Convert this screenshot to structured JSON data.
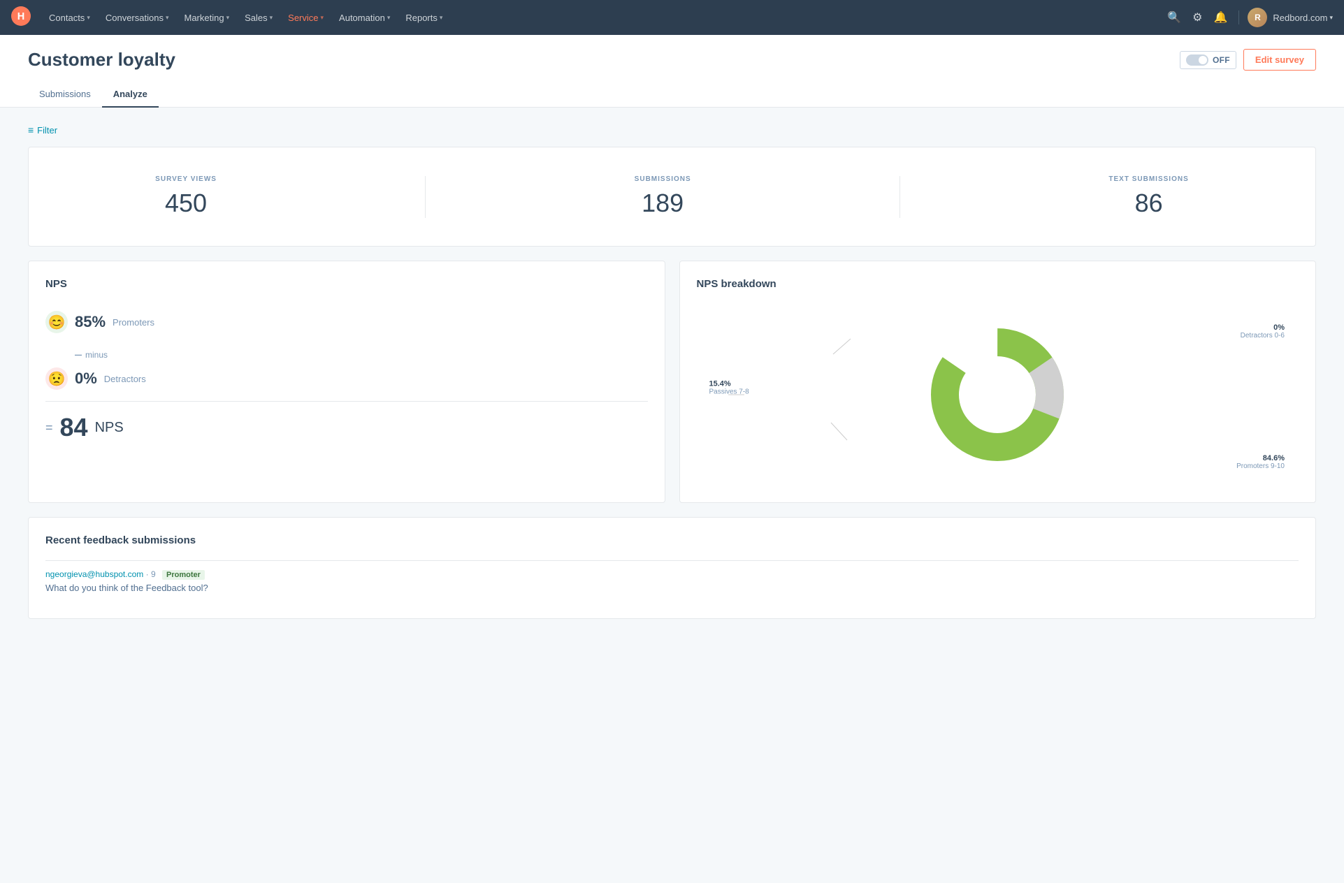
{
  "nav": {
    "items": [
      {
        "label": "Contacts",
        "has_dropdown": true
      },
      {
        "label": "Conversations",
        "has_dropdown": true
      },
      {
        "label": "Marketing",
        "has_dropdown": true
      },
      {
        "label": "Sales",
        "has_dropdown": true
      },
      {
        "label": "Service",
        "has_dropdown": true,
        "active": true
      },
      {
        "label": "Automation",
        "has_dropdown": true
      },
      {
        "label": "Reports",
        "has_dropdown": true
      }
    ],
    "domain": "Redbord.com",
    "avatar_initials": "R"
  },
  "page": {
    "title": "Customer loyalty",
    "toggle_label": "OFF",
    "edit_button": "Edit survey"
  },
  "tabs": [
    {
      "label": "Submissions",
      "active": false
    },
    {
      "label": "Analyze",
      "active": true
    }
  ],
  "filter": {
    "label": "Filter"
  },
  "stats": [
    {
      "label": "SURVEY VIEWS",
      "value": "450"
    },
    {
      "label": "SUBMISSIONS",
      "value": "189"
    },
    {
      "label": "TEXT SUBMISSIONS",
      "value": "86"
    }
  ],
  "nps": {
    "title": "NPS",
    "promoters_pct": "85%",
    "promoters_label": "Promoters",
    "minus_label": "minus",
    "detractors_pct": "0%",
    "detractors_label": "Detractors",
    "total_label": "NPS",
    "total_value": "84",
    "equals_symbol": "="
  },
  "breakdown": {
    "title": "NPS breakdown",
    "segments": [
      {
        "label": "Promoters 9-10",
        "pct": 84.6,
        "pct_label": "84.6%",
        "color": "#8bc34a"
      },
      {
        "label": "Passives 7-8",
        "pct": 15.4,
        "pct_label": "15.4%",
        "color": "#d0d0d0"
      },
      {
        "label": "Detractors 0-6",
        "pct": 0,
        "pct_label": "0%",
        "color": "#e0e0e0"
      }
    ],
    "labels": {
      "top": {
        "pct": "0%",
        "desc": "Detractors 0-6"
      },
      "left": {
        "pct": "15.4%",
        "desc": "Passives 7-8"
      },
      "bottom": {
        "pct": "84.6%",
        "desc": "Promoters 9-10"
      }
    }
  },
  "recent": {
    "title": "Recent feedback submissions",
    "items": [
      {
        "email": "ngeorgieva@hubspot.com",
        "score": "9",
        "type": "Promoter",
        "question": "What do you think of the Feedback tool?"
      }
    ]
  }
}
